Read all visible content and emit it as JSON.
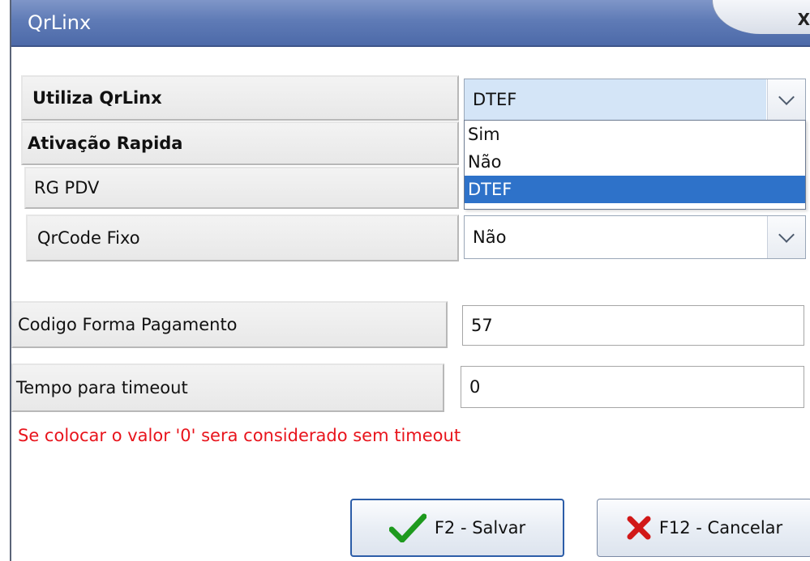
{
  "window": {
    "title": "QrLinx",
    "close_glyph": "X"
  },
  "fields": {
    "utiliza": {
      "label": "Utiliza QrLinx",
      "value": "DTEF"
    },
    "ativacao": {
      "label": "Ativação Rapida"
    },
    "rg_pdv": {
      "label": "RG PDV"
    },
    "qrcode_fixo": {
      "label": "QrCode Fixo",
      "value": "Não"
    },
    "codigo_forma": {
      "label": "Codigo Forma Pagamento",
      "value": "57"
    },
    "tempo_timeout": {
      "label": "Tempo para timeout",
      "value": "0"
    }
  },
  "dropdown": {
    "options": [
      "Sim",
      "Não",
      "DTEF"
    ],
    "selected": "DTEF"
  },
  "hint_text": "Se colocar o valor '0' sera considerado sem timeout",
  "buttons": {
    "save": {
      "label": "F2 - Salvar",
      "icon": "checkmark-icon",
      "color": "#1e9a1e"
    },
    "cancel": {
      "label": "F12 - Cancelar",
      "icon": "x-icon",
      "color": "#d11818"
    }
  },
  "colors": {
    "titlebar": "#5f7bb6",
    "selection": "#2e72c9",
    "hint": "#e8141c"
  }
}
